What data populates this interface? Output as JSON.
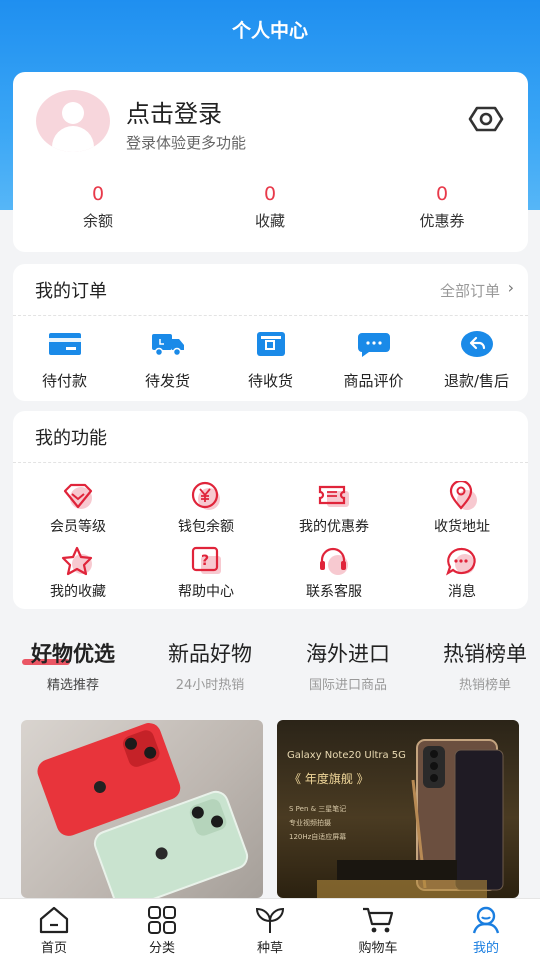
{
  "header": {
    "title": "个人中心"
  },
  "profile": {
    "login_title": "点击登录",
    "login_subtitle": "登录体验更多功能",
    "stats": [
      {
        "value": "0",
        "label": "余额"
      },
      {
        "value": "0",
        "label": "收藏"
      },
      {
        "value": "0",
        "label": "优惠券"
      }
    ]
  },
  "orders": {
    "title": "我的订单",
    "more": "全部订单",
    "items": [
      {
        "label": "待付款",
        "icon": "card-icon"
      },
      {
        "label": "待发货",
        "icon": "truck-icon"
      },
      {
        "label": "待收货",
        "icon": "box-icon"
      },
      {
        "label": "商品评价",
        "icon": "chat-icon"
      },
      {
        "label": "退款/售后",
        "icon": "return-icon"
      }
    ]
  },
  "functions": {
    "title": "我的功能",
    "items": [
      {
        "label": "会员等级",
        "icon": "diamond-icon"
      },
      {
        "label": "钱包余额",
        "icon": "yuan-icon"
      },
      {
        "label": "我的优惠券",
        "icon": "coupon-icon"
      },
      {
        "label": "收货地址",
        "icon": "location-icon"
      },
      {
        "label": "我的收藏",
        "icon": "star-icon"
      },
      {
        "label": "帮助中心",
        "icon": "help-icon"
      },
      {
        "label": "联系客服",
        "icon": "headset-icon"
      },
      {
        "label": "消息",
        "icon": "message-icon"
      }
    ]
  },
  "tabs": [
    {
      "title": "好物优选",
      "subtitle": "精选推荐"
    },
    {
      "title": "新品好物",
      "subtitle": "24小时热销"
    },
    {
      "title": "海外进口",
      "subtitle": "国际进口商品"
    },
    {
      "title": "热销榜单",
      "subtitle": "热销榜单"
    }
  ],
  "products": {
    "p2": {
      "title": "Galaxy Note20 Ultra 5G",
      "subtitle": "《 年度旗舰 》",
      "features": [
        "S Pen & 三星笔记",
        "专业视频拍摄",
        "120Hz自适应屏幕"
      ]
    }
  },
  "bottom_nav": [
    {
      "label": "首页",
      "icon": "home-icon"
    },
    {
      "label": "分类",
      "icon": "grid-icon"
    },
    {
      "label": "种草",
      "icon": "sprout-icon"
    },
    {
      "label": "购物车",
      "icon": "cart-icon"
    },
    {
      "label": "我的",
      "icon": "user-icon"
    }
  ],
  "colors": {
    "primary": "#1f8ff0",
    "accent": "#e8394a",
    "icon_blue": "#1a8ae8"
  }
}
